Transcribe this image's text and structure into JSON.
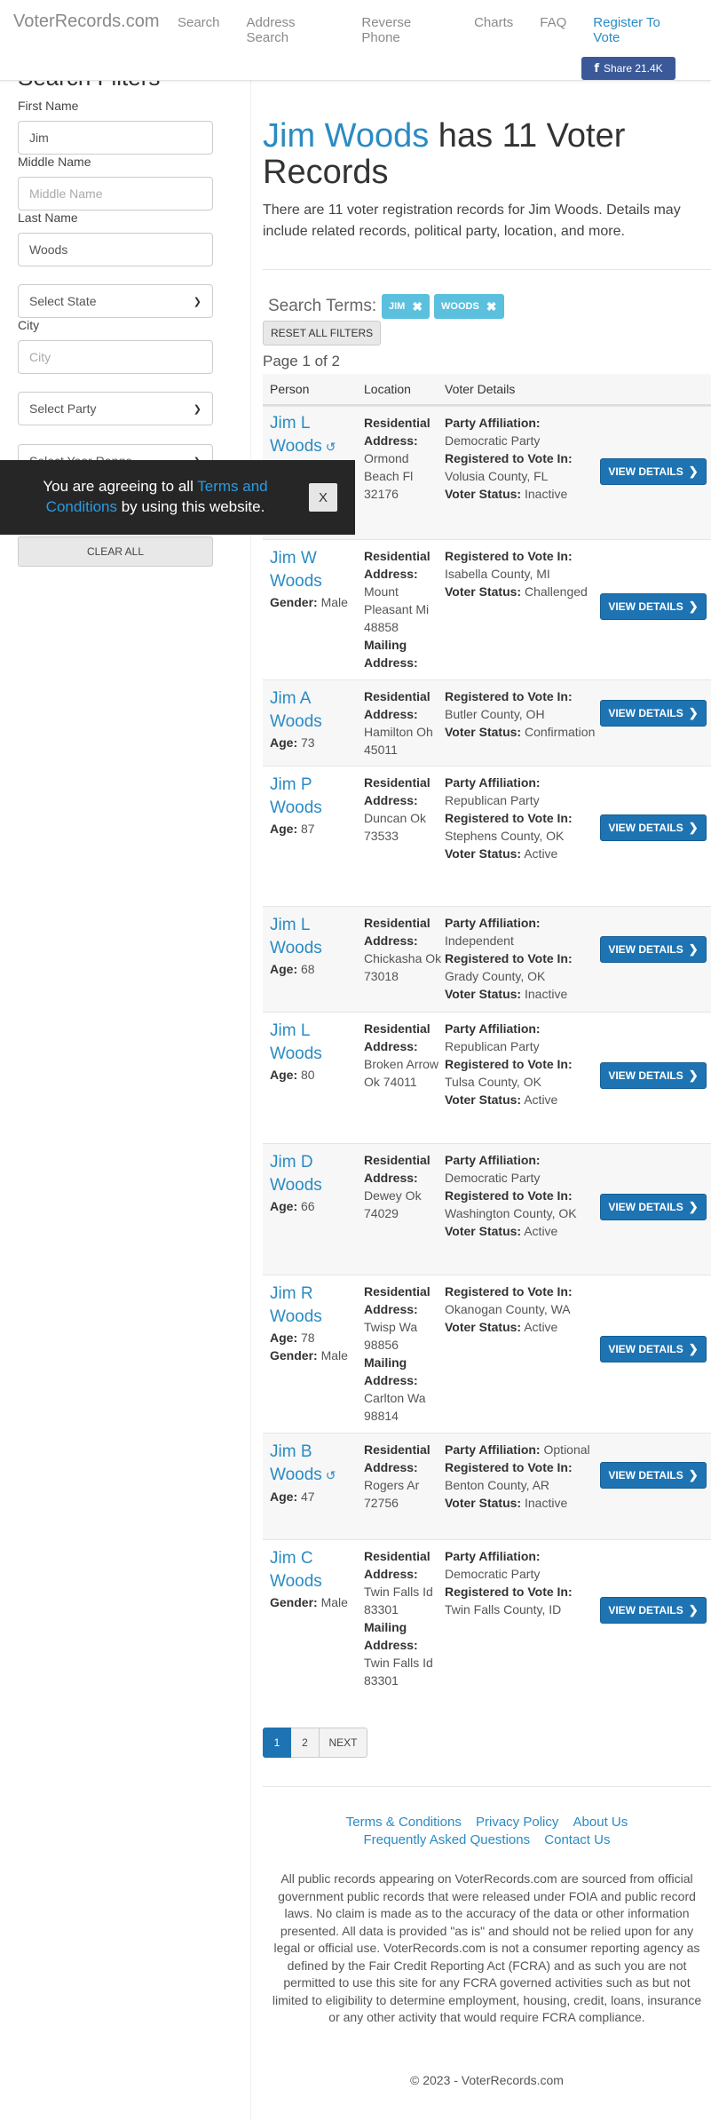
{
  "nav": {
    "brand": "VoterRecords.com",
    "links": [
      "Search",
      "Address Search",
      "Reverse Phone",
      "Charts",
      "FAQ"
    ],
    "register": "Register To Vote",
    "share": "Share 21.4K"
  },
  "sidebar": {
    "title": "Search Filters",
    "first_label": "First Name",
    "first_value": "Jim",
    "middle_label": "Middle Name",
    "middle_placeholder": "Middle Name",
    "last_label": "Last Name",
    "last_value": "Woods",
    "state_select": "Select State",
    "city_label": "City",
    "city_placeholder": "City",
    "party_select": "Select Party",
    "year_select": "Select Year Range",
    "clear_all": "CLEAR ALL"
  },
  "cookie": {
    "pre": "You are agreeing to all ",
    "link": "Terms and Conditions",
    "post": " by using this website.",
    "close": "X"
  },
  "main": {
    "name": "Jim Woods",
    "headline_rest": " has 11 Voter Records",
    "lead": "There are 11 voter registration records for Jim Woods. Details may include related records, political party, location, and more.",
    "search_terms_label": "Search Terms:",
    "tags": [
      "JIM",
      "WOODS"
    ],
    "reset": "RESET ALL FILTERS",
    "page_info": "Page 1 of 2",
    "columns": [
      "Person",
      "Location",
      "Voter Details"
    ],
    "view_details": "VIEW DETAILS"
  },
  "records": [
    {
      "first": "Jim L",
      "last": "Woods",
      "history": true,
      "info": [],
      "location": [
        [
          "Residential Address:",
          "Ormond Beach Fl 32176"
        ]
      ],
      "details": [
        [
          "Party Affiliation:",
          "Democratic Party"
        ],
        [
          "Registered to Vote In:",
          "Volusia County, FL"
        ],
        [
          "Voter Status:",
          "Inactive"
        ]
      ]
    },
    {
      "first": "Jim W",
      "last": "Woods",
      "history": false,
      "info": [
        [
          "Gender:",
          "Male"
        ]
      ],
      "location": [
        [
          "Residential Address:",
          "Mount Pleasant Mi 48858"
        ],
        [
          "Mailing Address:",
          ""
        ]
      ],
      "details": [
        [
          "Registered to Vote In:",
          "Isabella County, MI"
        ],
        [
          "Voter Status:",
          "Challenged"
        ]
      ]
    },
    {
      "first": "Jim A",
      "last": "Woods",
      "history": false,
      "info": [
        [
          "Age:",
          "73"
        ]
      ],
      "location": [
        [
          "Residential Address:",
          "Hamilton Oh 45011"
        ]
      ],
      "details": [
        [
          "Registered to Vote In:",
          "Butler County, OH"
        ],
        [
          "Voter Status:",
          "Confirmation"
        ]
      ]
    },
    {
      "first": "Jim P",
      "last": "Woods",
      "history": false,
      "info": [
        [
          "Age:",
          "87"
        ]
      ],
      "location": [
        [
          "Residential Address:",
          "Duncan Ok 73533"
        ]
      ],
      "details": [
        [
          "Party Affiliation:",
          "Republican Party"
        ],
        [
          "Registered to Vote In:",
          "Stephens County, OK"
        ],
        [
          "Voter Status:",
          "Active"
        ]
      ]
    },
    {
      "first": "Jim L",
      "last": "Woods",
      "history": false,
      "info": [
        [
          "Age:",
          "68"
        ]
      ],
      "location": [
        [
          "Residential Address:",
          "Chickasha Ok 73018"
        ]
      ],
      "details": [
        [
          "Party Affiliation:",
          "Independent"
        ],
        [
          "Registered to Vote In:",
          "Grady County, OK"
        ],
        [
          "Voter Status:",
          "Inactive"
        ]
      ]
    },
    {
      "first": "Jim L",
      "last": "Woods",
      "history": false,
      "info": [
        [
          "Age:",
          "80"
        ]
      ],
      "location": [
        [
          "Residential Address:",
          "Broken Arrow Ok 74011"
        ]
      ],
      "details": [
        [
          "Party Affiliation:",
          "Republican Party"
        ],
        [
          "Registered to Vote In:",
          "Tulsa County, OK"
        ],
        [
          "Voter Status:",
          "Active"
        ]
      ]
    },
    {
      "first": "Jim D",
      "last": "Woods",
      "history": false,
      "info": [
        [
          "Age:",
          "66"
        ]
      ],
      "location": [
        [
          "Residential Address:",
          "Dewey Ok 74029"
        ]
      ],
      "details": [
        [
          "Party Affiliation:",
          "Democratic Party"
        ],
        [
          "Registered to Vote In:",
          "Washington County, OK"
        ],
        [
          "Voter Status:",
          "Active"
        ]
      ]
    },
    {
      "first": "Jim R",
      "last": "Woods",
      "history": false,
      "info": [
        [
          "Age:",
          "78"
        ],
        [
          "Gender:",
          "Male"
        ]
      ],
      "location": [
        [
          "Residential Address:",
          "Twisp Wa 98856"
        ],
        [
          "Mailing Address:",
          "Carlton Wa 98814"
        ]
      ],
      "details": [
        [
          "Registered to Vote In:",
          "Okanogan County, WA"
        ],
        [
          "Voter Status:",
          "Active"
        ]
      ]
    },
    {
      "first": "Jim B",
      "last": "Woods",
      "history": true,
      "info": [
        [
          "Age:",
          "47"
        ]
      ],
      "location": [
        [
          "Residential Address:",
          "Rogers Ar 72756"
        ]
      ],
      "details": [
        [
          "Party Affiliation:",
          "Optional"
        ],
        [
          "Registered to Vote In:",
          "Benton County, AR"
        ],
        [
          "Voter Status:",
          "Inactive"
        ]
      ]
    },
    {
      "first": "Jim C",
      "last": "Woods",
      "history": false,
      "info": [
        [
          "Gender:",
          "Male"
        ]
      ],
      "location": [
        [
          "Residential Address:",
          "Twin Falls Id 83301"
        ],
        [
          "Mailing Address:",
          "Twin Falls Id 83301"
        ]
      ],
      "details": [
        [
          "Party Affiliation:",
          "Democratic Party"
        ],
        [
          "Registered to Vote In:",
          "Twin Falls County, ID"
        ]
      ]
    }
  ],
  "pagination": {
    "pages": [
      "1",
      "2"
    ],
    "next": "NEXT"
  },
  "footer": {
    "links_row1": [
      "Terms & Conditions",
      "Privacy Policy",
      "About Us"
    ],
    "links_row2": [
      "Frequently Asked Questions",
      "Contact Us"
    ],
    "disclaimer": "All public records appearing on VoterRecords.com are sourced from official government public records that were released under FOIA and public record laws. No claim is made as to the accuracy of the data or other information presented. All data is provided \"as is\" and should not be relied upon for any legal or official use. VoterRecords.com is not a consumer reporting agency as defined by the Fair Credit Reporting Act (FCRA) and as such you are not permitted to use this site for any FCRA governed activities such as but not limited to eligibility to determine employment, housing, credit, loans, insurance or any other activity that would require FCRA compliance.",
    "copyright": "© 2023 - VoterRecords.com"
  }
}
